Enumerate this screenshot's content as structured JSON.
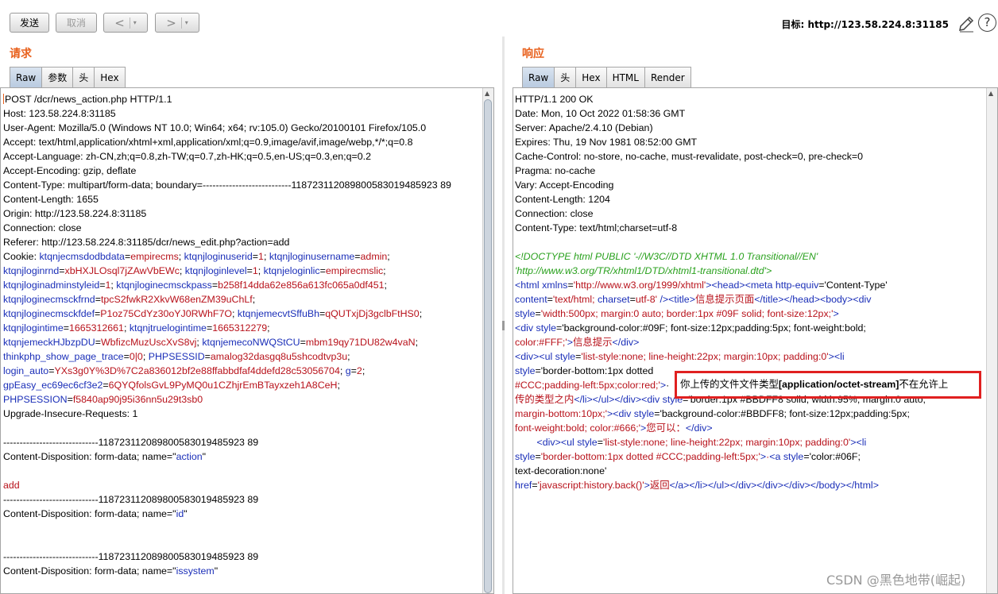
{
  "toolbar": {
    "send_label": "发送",
    "cancel_label": "取消",
    "back_label": "<",
    "forward_label": ">",
    "dropdown_glyph": "▾",
    "target_label": "目标: http://123.58.224.8:31185",
    "help_label": "?"
  },
  "request": {
    "title": "请求",
    "tabs": [
      "Raw",
      "参数",
      "头",
      "Hex"
    ],
    "active_tab": "Raw",
    "headers": [
      "POST /dcr/news_action.php HTTP/1.1",
      "Host: 123.58.224.8:31185",
      "User-Agent: Mozilla/5.0 (Windows NT 10.0; Win64; x64; rv:105.0) Gecko/20100101 Firefox/105.0",
      "Accept: text/html,application/xhtml+xml,application/xml;q=0.9,image/avif,image/webp,*/*;q=0.8",
      "Accept-Language: zh-CN,zh;q=0.8,zh-TW;q=0.7,zh-HK;q=0.5,en-US;q=0.3,en;q=0.2",
      "Accept-Encoding: gzip, deflate",
      "Content-Type: multipart/form-data; boundary=---------------------------118723112089800583019485923 89",
      "Content-Length: 1655",
      "Origin: http://123.58.224.8:31185",
      "Connection: close",
      "Referer: http://123.58.224.8:31185/dcr/news_edit.php?action=add"
    ],
    "cookies": [
      [
        "Cookie: ",
        "ktqnjecmsdodbdata",
        "empirecms",
        "ktqnjloginuserid",
        "1",
        "ktqnjloginusername",
        "admin"
      ],
      [
        "",
        "ktqnjloginrnd",
        "xbHXJLOsql7jZAwVbEWc",
        "ktqnjloginlevel",
        "1",
        "ktqnjeloginlic",
        "empirecmslic"
      ],
      [
        "",
        "ktqnjloginadminstyleid",
        "1",
        "ktqnjloginecmsckpass",
        "b258f14dda62e856a613fc065a0df451"
      ],
      [
        "",
        "ktqnjloginecmsckfrnd",
        "tpcS2fwkR2XkvW68enZM39uChLf"
      ],
      [
        "",
        "ktqnjloginecmsckfdef",
        "P1oz75CdYz30oYJ0RWhF7O",
        "ktqnjemecvtSffuBh",
        "qQUTxjDj3gclbFtHS0"
      ],
      [
        "",
        "ktqnjlogintime",
        "1665312661",
        "ktqnjtruelogintime",
        "1665312279"
      ],
      [
        "",
        "ktqnjemeckHJbzpDU",
        "WbfizcMuzUscXvS8vj",
        "ktqnjemecoNWQStCU",
        "mbm19qy71DU82w4vaN"
      ],
      [
        "",
        "thinkphp_show_page_trace",
        "0|0",
        "PHPSESSID",
        "amalog32dasgq8u5shcodtvp3u"
      ],
      [
        "",
        "login_auto",
        "YXs3g0Y%3D%7C2a836012bf2e88ffabbdfaf4ddefd28c53056704",
        "g",
        "2"
      ],
      [
        "",
        "gpEasy_ec69ec6cf3e2",
        "6QYQfolsGvL9PyMQ0u1CZhjrEmBTayxzeh1A8CeH"
      ],
      [
        "",
        "PHPSESSION",
        "f5840ap90j95i36nn5u29t3sb0"
      ]
    ],
    "after_cookie": "Upgrade-Insecure-Requests: 1",
    "body": [
      {
        "type": "blank",
        "text": ""
      },
      {
        "type": "plain",
        "text": "-----------------------------118723112089800583019485923 89"
      },
      {
        "type": "disp",
        "prefix": "Content-Disposition: form-data; name=\"",
        "name": "action",
        "suffix": "\""
      },
      {
        "type": "blank",
        "text": ""
      },
      {
        "type": "value",
        "text": "add"
      },
      {
        "type": "plain",
        "text": "-----------------------------118723112089800583019485923 89"
      },
      {
        "type": "disp",
        "prefix": "Content-Disposition: form-data; name=\"",
        "name": "id",
        "suffix": "\""
      },
      {
        "type": "blank",
        "text": ""
      },
      {
        "type": "blank",
        "text": ""
      },
      {
        "type": "plain",
        "text": "-----------------------------118723112089800583019485923 89"
      },
      {
        "type": "disp",
        "prefix": "Content-Disposition: form-data; name=\"",
        "name": "issystem",
        "suffix": "\""
      }
    ]
  },
  "response": {
    "title": "响应",
    "tabs": [
      "Raw",
      "头",
      "Hex",
      "HTML",
      "Render"
    ],
    "active_tab": "Raw",
    "headers": [
      "HTTP/1.1 200 OK",
      "Date: Mon, 10 Oct 2022 01:58:36 GMT",
      "Server: Apache/2.4.10 (Debian)",
      "Expires: Thu, 19 Nov 1981 08:52:00 GMT",
      "Cache-Control: no-store, no-cache, must-revalidate, post-check=0, pre-check=0",
      "Pragma: no-cache",
      "Vary: Accept-Encoding",
      "Content-Length: 1204",
      "Connection: close",
      "Content-Type: text/html;charset=utf-8"
    ],
    "doctype_1": "<!DOCTYPE html PUBLIC '-//W3C//DTD XHTML 1.0 Transitional//EN'",
    "doctype_2": "'http://www.w3.org/TR/xhtml1/DTD/xhtml1-transitional.dtd'>",
    "html_lines": [
      "<html xmlns='http://www.w3.org/1999/xhtml'><head><meta http-equiv='Content-Type'",
      "content='text/html; charset=utf-8' /><title>信息提示页面</title></head><body><div",
      "style='width:500px; margin:0 auto; border:1px #09F solid; font-size:12px;'>",
      "<div style='background-color:#09F; font-size:12px;padding:5px; font-weight:bold;",
      "color:#FFF;'>信息提示</div>",
      "<div><ul style='list-style:none; line-height:22px; margin:10px; padding:0'><li",
      "style='border-bottom:1px dotted",
      "#CCC;padding-left:5px;color:red;'>·",
      "传的类型之内</li></ul></div><div style='border:1px #BBDFF8 solid; width:95%; margin:0 auto;",
      "margin-bottom:10px;'><div style='background-color:#BBDFF8; font-size:12px;padding:5px;",
      "font-weight:bold; color:#666;'>您可以：</div>",
      "        <div><ul style='list-style:none; line-height:22px; margin:10px; padding:0'><li",
      "style='border-bottom:1px dotted #CCC;padding-left:5px;'>·<a style='color:#06F;",
      "text-decoration:none'",
      "href='javascript:history.back()'>返回</a></li></ul></div></div></div></body></html>"
    ],
    "highlight_pre": "你上传的文件文件类型",
    "highlight_bold": "[application/octet-stream]",
    "highlight_post": "不在允许上"
  },
  "watermark": "CSDN @黑色地带(崛起)"
}
